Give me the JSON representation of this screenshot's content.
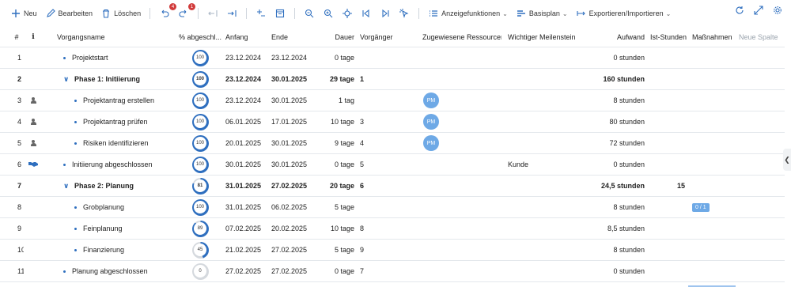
{
  "toolbar": {
    "new_label": "Neu",
    "edit_label": "Bearbeiten",
    "delete_label": "Löschen",
    "undo_badge": "4",
    "redo_badge": "1",
    "view_features_label": "Anzeigefunktionen",
    "baseline_label": "Basisplan",
    "export_import_label": "Exportieren/Importieren"
  },
  "columns": {
    "num": "#",
    "info": "i",
    "name": "Vorgangsname",
    "pct": "% abgeschl...",
    "start": "Anfang",
    "end": "Ende",
    "duration": "Dauer",
    "predecessor": "Vorgänger",
    "resources": "Zugewiesene Ressourcen",
    "milestone": "Wichtiger Meilenstein",
    "work": "Aufwand",
    "actual_hours": "Ist-Stunden",
    "measures": "Maßnahmen",
    "new_column": "Neue Spalte"
  },
  "rows": [
    {
      "num": "1",
      "name": "Projektstart",
      "level": 0,
      "summary": false,
      "pct": "100",
      "pct_value": 100,
      "start": "23.12.2024",
      "end": "23.12.2024",
      "duration": "0 tage",
      "pred": "",
      "res": "",
      "mile": "",
      "work": "0 stunden",
      "actual": "",
      "measure": "",
      "icon": ""
    },
    {
      "num": "2",
      "name": "Phase 1: Initiierung",
      "level": 0,
      "summary": true,
      "pct": "100",
      "pct_value": 100,
      "start": "23.12.2024",
      "end": "30.01.2025",
      "duration": "29 tage",
      "pred": "1",
      "res": "",
      "mile": "",
      "work": "160 stunden",
      "actual": "",
      "measure": "",
      "icon": ""
    },
    {
      "num": "3",
      "name": "Projektantrag erstellen",
      "level": 1,
      "summary": false,
      "pct": "100",
      "pct_value": 100,
      "start": "23.12.2024",
      "end": "30.01.2025",
      "duration": "1 tag",
      "pred": "",
      "res": "PM",
      "mile": "",
      "work": "8 stunden",
      "actual": "",
      "measure": "",
      "icon": "person"
    },
    {
      "num": "4",
      "name": "Projektantrag prüfen",
      "level": 1,
      "summary": false,
      "pct": "100",
      "pct_value": 100,
      "start": "06.01.2025",
      "end": "17.01.2025",
      "duration": "10 tage",
      "pred": "3",
      "res": "PM",
      "mile": "",
      "work": "80 stunden",
      "actual": "",
      "measure": "",
      "icon": "person"
    },
    {
      "num": "5",
      "name": "Risiken identifizieren",
      "level": 1,
      "summary": false,
      "pct": "100",
      "pct_value": 100,
      "start": "20.01.2025",
      "end": "30.01.2025",
      "duration": "9 tage",
      "pred": "4",
      "res": "PM",
      "mile": "",
      "work": "72 stunden",
      "actual": "",
      "measure": "",
      "icon": "person"
    },
    {
      "num": "6",
      "name": "Initiierung abgeschlossen",
      "level": 0,
      "summary": false,
      "pct": "100",
      "pct_value": 100,
      "start": "30.01.2025",
      "end": "30.01.2025",
      "duration": "0 tage",
      "pred": "5",
      "res": "",
      "mile": "Kunde",
      "work": "0 stunden",
      "actual": "",
      "measure": "",
      "icon": "handshake"
    },
    {
      "num": "7",
      "name": "Phase 2: Planung",
      "level": 0,
      "summary": true,
      "pct": "81",
      "pct_value": 81,
      "start": "31.01.2025",
      "end": "27.02.2025",
      "duration": "20 tage",
      "pred": "6",
      "res": "",
      "mile": "",
      "work": "24,5 stunden",
      "actual": "15",
      "measure": "",
      "icon": ""
    },
    {
      "num": "8",
      "name": "Grobplanung",
      "level": 1,
      "summary": false,
      "pct": "100",
      "pct_value": 100,
      "start": "31.01.2025",
      "end": "06.02.2025",
      "duration": "5 tage",
      "pred": "",
      "res": "",
      "mile": "",
      "work": "8 stunden",
      "actual": "",
      "measure": "0 / 1",
      "icon": ""
    },
    {
      "num": "9",
      "name": "Feinplanung",
      "level": 1,
      "summary": false,
      "pct": "89",
      "pct_value": 89,
      "start": "07.02.2025",
      "end": "20.02.2025",
      "duration": "10 tage",
      "pred": "8",
      "res": "",
      "mile": "",
      "work": "8,5 stunden",
      "actual": "",
      "measure": "",
      "icon": ""
    },
    {
      "num": "10",
      "name": "Finanzierung",
      "level": 1,
      "summary": false,
      "pct": "45",
      "pct_value": 45,
      "start": "21.02.2025",
      "end": "27.02.2025",
      "duration": "5 tage",
      "pred": "9",
      "res": "",
      "mile": "",
      "work": "8 stunden",
      "actual": "",
      "measure": "",
      "icon": ""
    },
    {
      "num": "11",
      "name": "Planung abgeschlossen",
      "level": 0,
      "summary": false,
      "pct": "0",
      "pct_value": 0,
      "start": "27.02.2025",
      "end": "27.02.2025",
      "duration": "0 tage",
      "pred": "7",
      "res": "",
      "mile": "",
      "work": "0 stunden",
      "actual": "",
      "measure": "",
      "icon": ""
    }
  ],
  "colors": {
    "accent": "#2f6fbf",
    "ring_track": "#d5d9de",
    "avatar": "#6ea9e6"
  }
}
